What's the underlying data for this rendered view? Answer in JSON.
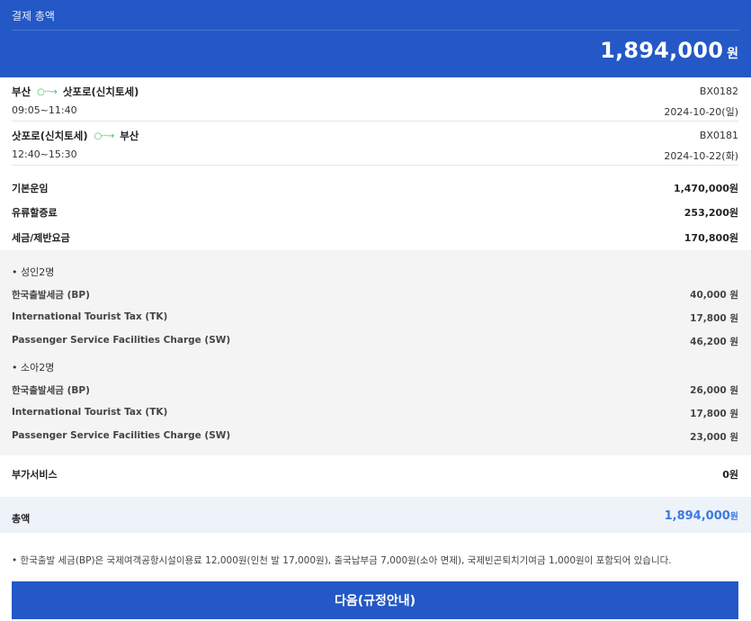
{
  "header": {
    "label": "결제 총액",
    "total_amount": "1,894,000",
    "currency": "원"
  },
  "segments": [
    {
      "from": "부산",
      "to": "삿포로(신치토세)",
      "time": "09:05~11:40",
      "flight": "BX0182",
      "date": "2024-10-20(일)"
    },
    {
      "from": "삿포로(신치토세)",
      "to": "부산",
      "time": "12:40~15:30",
      "flight": "BX0181",
      "date": "2024-10-22(화)"
    }
  ],
  "fare": {
    "base_label": "기본운임",
    "base_value": "1,470,000원",
    "fuel_label": "유류할증료",
    "fuel_value": "253,200원",
    "tax_label": "세금/제반요금",
    "tax_value": "170,800원"
  },
  "tax_groups": [
    {
      "title": "• 성인2명",
      "items": [
        {
          "label": "한국출발세금 (BP)",
          "value": "40,000 원"
        },
        {
          "label": "International Tourist Tax (TK)",
          "value": "17,800 원"
        },
        {
          "label": "Passenger Service Facilities Charge (SW)",
          "value": "46,200 원"
        }
      ]
    },
    {
      "title": "• 소아2명",
      "items": [
        {
          "label": "한국출발세금 (BP)",
          "value": "26,000 원"
        },
        {
          "label": "International Tourist Tax (TK)",
          "value": "17,800 원"
        },
        {
          "label": "Passenger Service Facilities Charge (SW)",
          "value": "23,000 원"
        }
      ]
    }
  ],
  "addon": {
    "label": "부가서비스",
    "value": "0원"
  },
  "summary": {
    "label": "총액",
    "amount": "1,894,000",
    "currency": "원"
  },
  "note": "• 한국출발 세금(BP)은 국제여객공항시설이용료 12,000원(인천 발 17,000원), 출국납부금 7,000원(소아 면제), 국제빈곤퇴치기여금 1,000원이 포함되어 있습니다.",
  "next_button": "다음(규정안내)",
  "colors": {
    "primary": "#2358c6",
    "accent_amount": "#3d7ae0",
    "route_arrow": "#3fbf5a"
  },
  "icons": {
    "route_arrow": "dotted-arrow-icon"
  }
}
